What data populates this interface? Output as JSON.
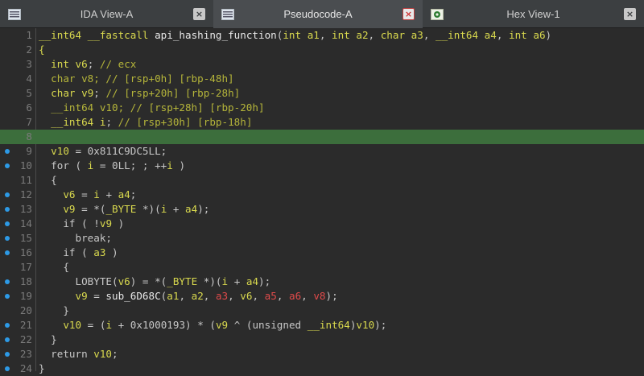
{
  "tabs": [
    {
      "label": "IDA View-A",
      "icon": "ida-view-icon",
      "active": false,
      "close": "×"
    },
    {
      "label": "Pseudocode-A",
      "icon": "pseudocode-icon",
      "active": true,
      "close": "×"
    },
    {
      "label": "Hex View-1",
      "icon": "hex-view-icon",
      "active": false,
      "close": "×"
    }
  ],
  "lines": [
    {
      "n": "1",
      "dot": false,
      "hl": false,
      "html": "<span class='kw'>__int64</span> <span class='kw'>__fastcall</span> <span class='fn'>api_hashing_function</span>(<span class='kw'>int</span> <span class='var'>a1</span>, <span class='kw'>int</span> <span class='var'>a2</span>, <span class='kw'>char</span> <span class='var'>a3</span>, <span class='kw'>__int64</span> <span class='var'>a4</span>, <span class='kw'>int</span> <span class='var'>a6</span>)"
    },
    {
      "n": "2",
      "dot": false,
      "hl": false,
      "html": "<span class='kw'>{</span>"
    },
    {
      "n": "3",
      "dot": false,
      "hl": false,
      "html": "  <span class='kw'>int</span> <span class='var'>v6</span>; <span class='cm'>// ecx</span>"
    },
    {
      "n": "4",
      "dot": false,
      "hl": false,
      "html": "  <span class='cm'>char v8; // [rsp+0h] [rbp-48h]</span>"
    },
    {
      "n": "5",
      "dot": false,
      "hl": false,
      "html": "  <span class='kw'>char</span> <span class='var'>v9</span>; <span class='cm'>// [rsp+20h] [rbp-28h]</span>"
    },
    {
      "n": "6",
      "dot": false,
      "hl": false,
      "html": "  <span class='cm'>__int64 v10; // [rsp+28h] [rbp-20h]</span>"
    },
    {
      "n": "7",
      "dot": false,
      "hl": false,
      "html": "  <span class='kw'>__int64</span> <span class='var'>i</span>; <span class='cm'>// [rsp+30h] [rbp-18h]</span>"
    },
    {
      "n": "8",
      "dot": false,
      "hl": true,
      "html": ""
    },
    {
      "n": "9",
      "dot": true,
      "hl": false,
      "html": "  <span class='var'>v10</span> = <span class='num'>0x811C9DC5LL</span>;"
    },
    {
      "n": "10",
      "dot": true,
      "hl": false,
      "html": "  <span class='lbl'>for</span> ( <span class='var'>i</span> = <span class='num'>0LL</span>; ; ++<span class='var'>i</span> )"
    },
    {
      "n": "11",
      "dot": false,
      "hl": false,
      "html": "  {"
    },
    {
      "n": "12",
      "dot": true,
      "hl": false,
      "html": "    <span class='var'>v6</span> = <span class='var'>i</span> + <span class='var'>a4</span>;"
    },
    {
      "n": "13",
      "dot": true,
      "hl": false,
      "html": "    <span class='var'>v9</span> = *(<span class='typ'>_BYTE</span> *)(<span class='var'>i</span> + <span class='var'>a4</span>);"
    },
    {
      "n": "14",
      "dot": true,
      "hl": false,
      "html": "    <span class='lbl'>if</span> ( !<span class='var'>v9</span> )"
    },
    {
      "n": "15",
      "dot": true,
      "hl": false,
      "html": "      <span class='lbl'>break</span>;"
    },
    {
      "n": "16",
      "dot": true,
      "hl": false,
      "html": "    <span class='lbl'>if</span> ( <span class='var'>a3</span> )"
    },
    {
      "n": "17",
      "dot": false,
      "hl": false,
      "html": "    {"
    },
    {
      "n": "18",
      "dot": true,
      "hl": false,
      "html": "      <span class='lbl'>LOBYTE</span>(<span class='var'>v6</span>) = *(<span class='typ'>_BYTE</span> *)(<span class='var'>i</span> + <span class='var'>a4</span>);"
    },
    {
      "n": "19",
      "dot": true,
      "hl": false,
      "html": "      <span class='var'>v9</span> = <span class='fn'>sub_6D68C</span>(<span class='var'>a1</span>, <span class='var'>a2</span>, <span class='red'>a3</span>, <span class='var'>v6</span>, <span class='red'>a5</span>, <span class='red'>a6</span>, <span class='red'>v8</span>);"
    },
    {
      "n": "20",
      "dot": false,
      "hl": false,
      "html": "    }"
    },
    {
      "n": "21",
      "dot": true,
      "hl": false,
      "html": "    <span class='var'>v10</span> = (<span class='var'>i</span> + <span class='num'>0x1000193</span>) * (<span class='var'>v9</span> ^ (<span class='lbl'>unsigned</span> <span class='kw'>__int64</span>)<span class='var'>v10</span>);"
    },
    {
      "n": "22",
      "dot": true,
      "hl": false,
      "html": "  }"
    },
    {
      "n": "23",
      "dot": true,
      "hl": false,
      "html": "  <span class='lbl'>return</span> <span class='var'>v10</span>;"
    },
    {
      "n": "24",
      "dot": true,
      "hl": false,
      "html": "}"
    }
  ]
}
